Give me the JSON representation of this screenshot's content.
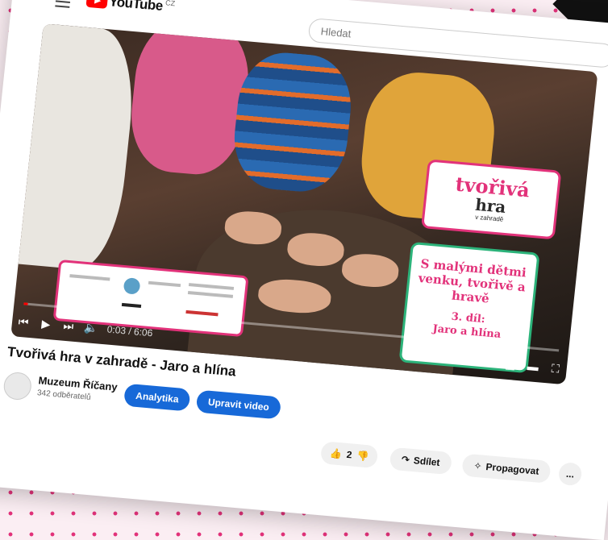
{
  "header": {
    "brand": "YouTube",
    "country": "CZ",
    "search_placeholder": "Hledat"
  },
  "video": {
    "promo_logo_line1": "tvořivá",
    "promo_logo_line2": "hra",
    "promo_logo_line3": "v zahradě",
    "promo_main": "S malými dětmi venku, tvořivě a hravě",
    "promo_episode_line1": "3. díl:",
    "promo_episode_line2": "Jaro a hlína",
    "time": "0:03 / 6:06",
    "progress": 0.008
  },
  "title": "Tvořivá hra v zahradě - Jaro a hlína",
  "channel": {
    "name": "Muzeum Říčany",
    "subscribers": "342 odběratelů",
    "analytics_label": "Analytika",
    "edit_label": "Upravit video"
  },
  "actions": {
    "like_count": "2",
    "share_label": "Sdílet",
    "promote_label": "Propagovat",
    "more_label": "..."
  },
  "colors": {
    "accent_pink": "#e2327a",
    "accent_green": "#2cb37a",
    "youtube_red": "#ff0000",
    "button_blue": "#1769d8"
  }
}
